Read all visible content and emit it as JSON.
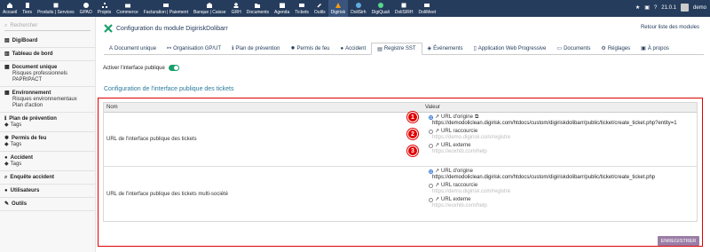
{
  "topbar": {
    "menu": [
      {
        "label": "Accueil",
        "icon": "home-icon"
      },
      {
        "label": "Tiers",
        "icon": "building-icon"
      },
      {
        "label": "Produits | Services",
        "icon": "cube-icon"
      },
      {
        "label": "GPAO",
        "icon": "cog-icon"
      },
      {
        "label": "Projets",
        "icon": "sitemap-icon"
      },
      {
        "label": "Commerce",
        "icon": "briefcase-icon"
      },
      {
        "label": "Facturation | Paiement",
        "icon": "money-icon"
      },
      {
        "label": "Banque | Caisse",
        "icon": "bank-icon"
      },
      {
        "label": "GRH",
        "icon": "users-icon"
      },
      {
        "label": "Documents",
        "icon": "folder-icon"
      },
      {
        "label": "Agenda",
        "icon": "calendar-icon"
      },
      {
        "label": "Tickets",
        "icon": "ticket-icon"
      },
      {
        "label": "Outils",
        "icon": "wrench-icon"
      },
      {
        "label": "Digirisk",
        "icon": "digirisk-icon"
      },
      {
        "label": "DoliSirh",
        "icon": "dolisirh-icon"
      },
      {
        "label": "DigiQuali",
        "icon": "digiquali-icon"
      },
      {
        "label": "DoliSIRH",
        "icon": "dolisirh2-icon"
      },
      {
        "label": "DoliMeet",
        "icon": "dolimeet-icon"
      }
    ],
    "version": "21.0.1",
    "user": "demo"
  },
  "sidebar": {
    "search_placeholder": "Rechercher",
    "groups": [
      {
        "title": "DigiBoard",
        "items": [],
        "tags": []
      },
      {
        "title": "Tableau de bord",
        "items": [],
        "tags": []
      },
      {
        "title": "Document unique",
        "items": [
          "Risques professionnels",
          "PAPRIPACT"
        ],
        "tags": []
      },
      {
        "title": "Environnement",
        "items": [
          "Risques environnementaux",
          "Plan d'action"
        ],
        "tags": []
      },
      {
        "title": "Plan de prévention",
        "items": [],
        "tags": [
          "Tags"
        ]
      },
      {
        "title": "Permis de feu",
        "items": [],
        "tags": [
          "Tags"
        ]
      },
      {
        "title": "Accident",
        "items": [],
        "tags": [
          "Tags"
        ]
      },
      {
        "title": "Enquête accident",
        "items": [],
        "tags": []
      },
      {
        "title": "Utilisateurs",
        "items": [],
        "tags": []
      },
      {
        "title": "Outils",
        "items": [],
        "tags": []
      }
    ]
  },
  "page": {
    "title": "Configuration du module DigiriskDolibarr",
    "back_link": "Retour liste des modules",
    "tabs": [
      {
        "label": "Document unique",
        "icon": "a-icon"
      },
      {
        "label": "Organisation GP/UT",
        "icon": "network-icon"
      },
      {
        "label": "Plan de prévention",
        "icon": "info-icon"
      },
      {
        "label": "Permis de feu",
        "icon": "fire-icon"
      },
      {
        "label": "Accident",
        "icon": "user-icon"
      },
      {
        "label": "Registre SST",
        "icon": "register-icon"
      },
      {
        "label": "Événements",
        "icon": "events-icon"
      },
      {
        "label": "Application Web Progressive",
        "icon": "mobile-icon"
      },
      {
        "label": "Documents",
        "icon": "doc-icon"
      },
      {
        "label": "Réglages",
        "icon": "settings-icon"
      },
      {
        "label": "À propos",
        "icon": "about-icon"
      }
    ],
    "active_tab": "Registre SST",
    "public_interface_label": "Activer l'interface publique",
    "public_interface_enabled": true,
    "section_title": "Configuration de l'interface publique des tickets",
    "table": {
      "col_name": "Nom",
      "col_value": "Valeur",
      "rows": [
        {
          "name": "URL de l'interface publique des tickets",
          "opt1": "URL d'origine",
          "url1": "https://demodoliclean.digirisk.com/htdocs/custom/digiriskdolibarr/public/ticket/create_ticket.php?entity=1",
          "opt2": "URL raccourcie",
          "ph2": "https://demo.digirisk.com/registre",
          "opt3": "URL externe",
          "ph3": "https://eoxhib.com/help"
        },
        {
          "name": "URL de l'interface publique des tickets multi-société",
          "opt1": "URL d'origine",
          "url1": "https://demodoliclean.digirisk.com/htdocs/custom/digiriskdolibarr/public/ticket/create_ticket.php",
          "opt2": "URL raccourcie",
          "ph2": "https://demo.digirisk.com/registre",
          "opt3": "URL externe",
          "ph3": "https://eoxhib.com/help"
        }
      ]
    },
    "badges": [
      "1",
      "2",
      "3"
    ],
    "save_label": "ENREGISTRER"
  },
  "colors": {
    "topbar": "#263c5c",
    "toggle": "#1a9f6b",
    "highlight": "#e00000",
    "save": "#9b7da6"
  }
}
